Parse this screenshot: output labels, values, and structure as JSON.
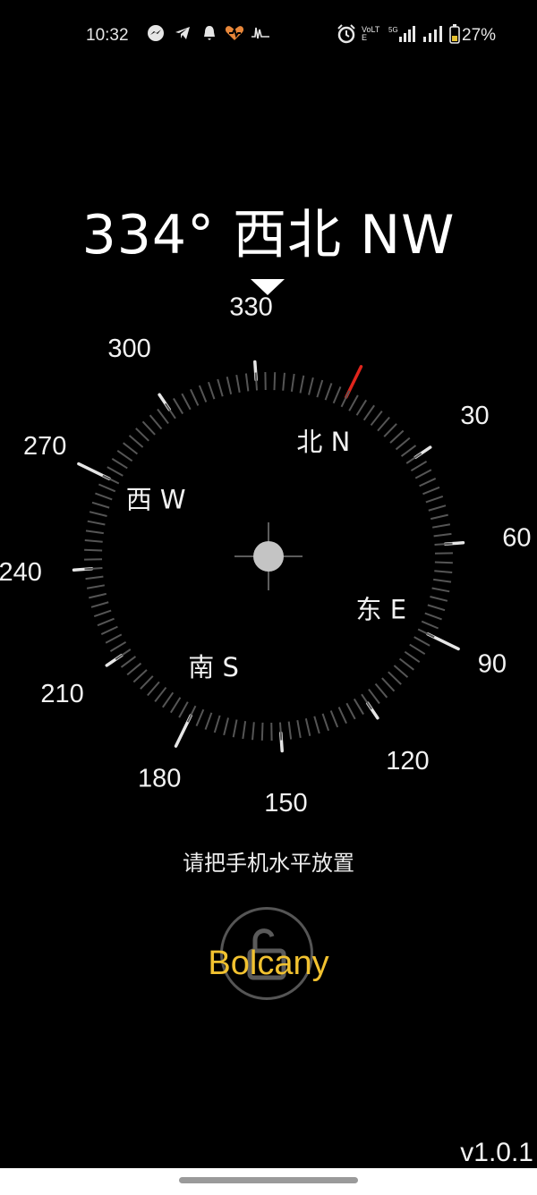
{
  "status_bar": {
    "time": "10:32",
    "volte": "VoLTE",
    "battery": "27%"
  },
  "compass": {
    "heading_text": "334° 西北 NW",
    "heading_deg": 334,
    "ring_labels": [
      "330",
      "30",
      "60",
      "90",
      "120",
      "150",
      "180",
      "210",
      "240",
      "270",
      "300"
    ],
    "directions": {
      "north": "北 N",
      "east": "东 E",
      "south": "南 S",
      "west": "西 W"
    }
  },
  "hint": "请把手机水平放置",
  "brand": "Bolcany",
  "version": "v1.0.1",
  "colors": {
    "north_marker": "#e0251c",
    "brand": "#f2c230",
    "background": "#000000"
  },
  "icons": [
    "messenger-icon",
    "telegram-icon",
    "bell-icon",
    "heart-app-icon",
    "pulse-icon",
    "alarm-icon",
    "signal-5g-icon",
    "signal-icon",
    "battery-icon",
    "lock-open-icon"
  ]
}
